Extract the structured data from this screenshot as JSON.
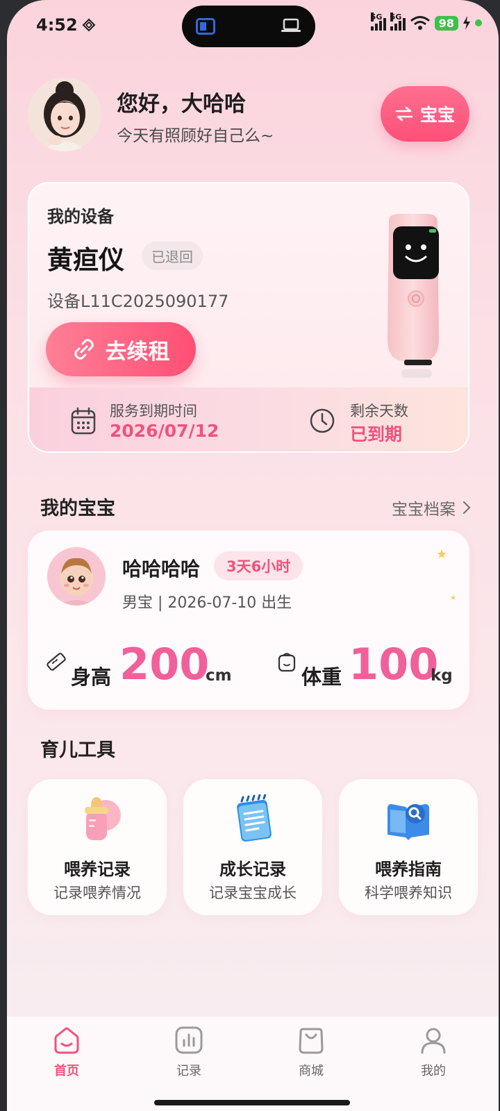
{
  "status_bar": {
    "time": "4:52",
    "signal_1": "5G",
    "signal_2": "5G",
    "battery": "98"
  },
  "header": {
    "greeting": "您好，大哈哈",
    "subtitle": "今天有照顾好自己么~",
    "switch_label": "宝宝"
  },
  "device": {
    "section_label": "我的设备",
    "name": "黄疸仪",
    "status": "已退回",
    "serial": "设备L11C2025090177",
    "renew_label": "去续租",
    "expiry_label": "服务到期时间",
    "expiry_value": "2026/07/12",
    "remaining_label": "剩余天数",
    "remaining_value": "已到期"
  },
  "baby": {
    "section_title": "我的宝宝",
    "archive_link": "宝宝档案",
    "name": "哈哈哈哈",
    "age_badge": "3天6小时",
    "info": "男宝 | 2026-07-10 出生",
    "height_label": "身高",
    "height_value": "200",
    "height_unit": "cm",
    "weight_label": "体重",
    "weight_value": "100",
    "weight_unit": "kg"
  },
  "tools": {
    "section_title": "育儿工具",
    "items": [
      {
        "name": "喂养记录",
        "desc": "记录喂养情况",
        "icon": "baby-bottle-icon"
      },
      {
        "name": "成长记录",
        "desc": "记录宝宝成长",
        "icon": "notepad-icon"
      },
      {
        "name": "喂养指南",
        "desc": "科学喂养知识",
        "icon": "guide-book-icon"
      }
    ]
  },
  "nav": {
    "items": [
      {
        "label": "首页",
        "icon": "home-icon",
        "active": true
      },
      {
        "label": "记录",
        "icon": "chart-icon",
        "active": false
      },
      {
        "label": "商城",
        "icon": "shopping-bag-icon",
        "active": false
      },
      {
        "label": "我的",
        "icon": "user-icon",
        "active": false
      }
    ]
  },
  "colors": {
    "accent": "#f0527d",
    "accent_button": "#ff4f79",
    "background_top": "#fbd3dd"
  }
}
